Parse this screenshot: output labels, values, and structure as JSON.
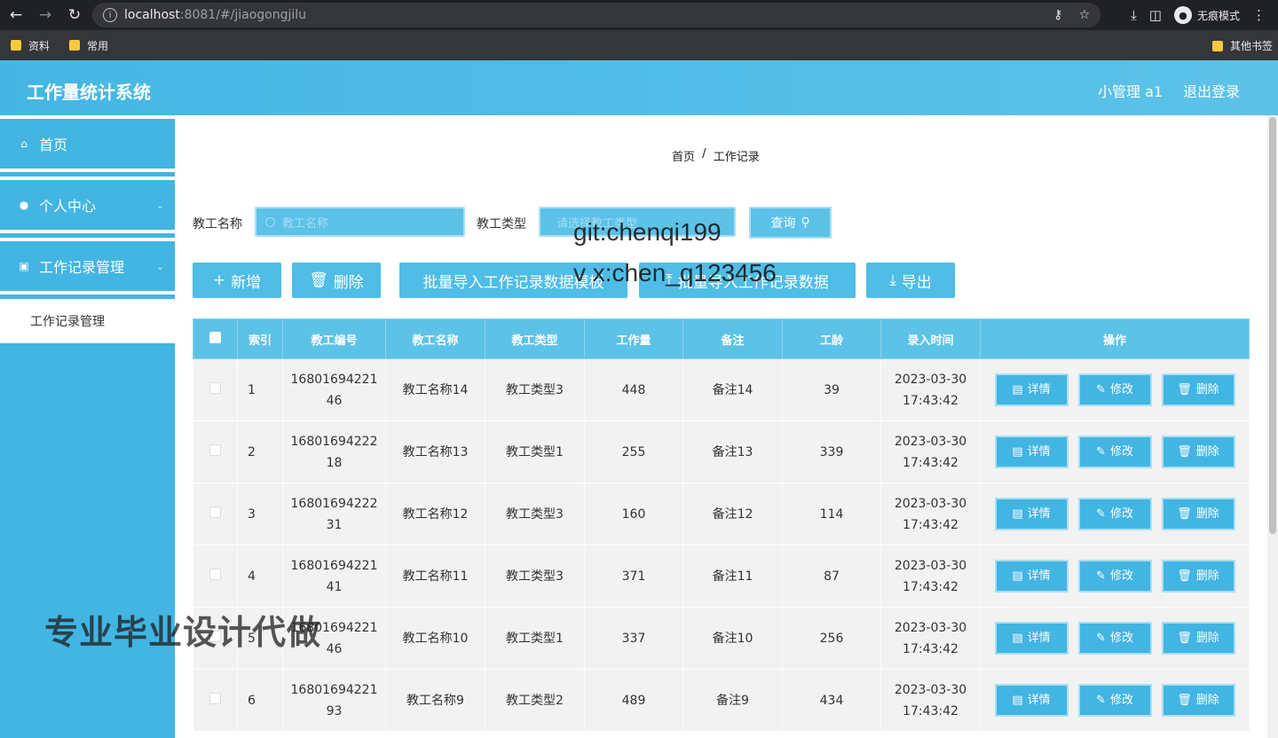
{
  "browser": {
    "url_host": "localhost",
    "url_rest": ":8081/#/jiaogongjilu",
    "incognito_label": "无痕模式",
    "bookmarks": [
      "资料",
      "常用"
    ],
    "other_bookmarks": "其他书签"
  },
  "header": {
    "title": "工作量统计系统",
    "user": "小管理 a1",
    "logout": "退出登录"
  },
  "sidebar": {
    "items": [
      {
        "label": "首页",
        "icon": "home-icon"
      },
      {
        "label": "个人中心",
        "icon": "user-icon"
      },
      {
        "label": "工作记录管理",
        "icon": "briefcase-icon"
      }
    ],
    "submenu": "工作记录管理"
  },
  "breadcrumb": {
    "home": "首页",
    "sep": "/",
    "current": "工作记录"
  },
  "filters": {
    "name_label": "教工名称",
    "name_placeholder": "教工名称",
    "type_label": "教工类型",
    "type_placeholder": "请选择教工类型",
    "query": "查询"
  },
  "actions": {
    "add": "新增",
    "delete": "删除",
    "import_template": "批量导入工作记录数据模板",
    "import_data": "批量导入工作记录数据",
    "export": "导出"
  },
  "watermarks": {
    "git": "git:chenqi199",
    "vx": "v x:chen_q123456",
    "cn": "专业毕业设计代做"
  },
  "table": {
    "headers": [
      "索引",
      "教工编号",
      "教工名称",
      "教工类型",
      "工作量",
      "备注",
      "工龄",
      "录入时间",
      "操作"
    ],
    "rows": [
      {
        "idx": "1",
        "code1": "16801694221",
        "code2": "46",
        "name": "教工名称14",
        "type": "教工类型3",
        "workload": "448",
        "note": "备注14",
        "years": "39",
        "date": "2023-03-30",
        "time": "17:43:42"
      },
      {
        "idx": "2",
        "code1": "16801694222",
        "code2": "18",
        "name": "教工名称13",
        "type": "教工类型1",
        "workload": "255",
        "note": "备注13",
        "years": "339",
        "date": "2023-03-30",
        "time": "17:43:42"
      },
      {
        "idx": "3",
        "code1": "16801694222",
        "code2": "31",
        "name": "教工名称12",
        "type": "教工类型3",
        "workload": "160",
        "note": "备注12",
        "years": "114",
        "date": "2023-03-30",
        "time": "17:43:42"
      },
      {
        "idx": "4",
        "code1": "16801694221",
        "code2": "41",
        "name": "教工名称11",
        "type": "教工类型3",
        "workload": "371",
        "note": "备注11",
        "years": "87",
        "date": "2023-03-30",
        "time": "17:43:42"
      },
      {
        "idx": "5",
        "code1": "16801694221",
        "code2": "46",
        "name": "教工名称10",
        "type": "教工类型1",
        "workload": "337",
        "note": "备注10",
        "years": "256",
        "date": "2023-03-30",
        "time": "17:43:42"
      },
      {
        "idx": "6",
        "code1": "16801694221",
        "code2": "93",
        "name": "教工名称9",
        "type": "教工类型2",
        "workload": "489",
        "note": "备注9",
        "years": "434",
        "date": "2023-03-30",
        "time": "17:43:42"
      }
    ],
    "ops": {
      "detail": "详情",
      "edit": "修改",
      "delete": "删除"
    }
  },
  "colors": {
    "primary": "#42b5e3",
    "header": "#5cc2e8"
  }
}
